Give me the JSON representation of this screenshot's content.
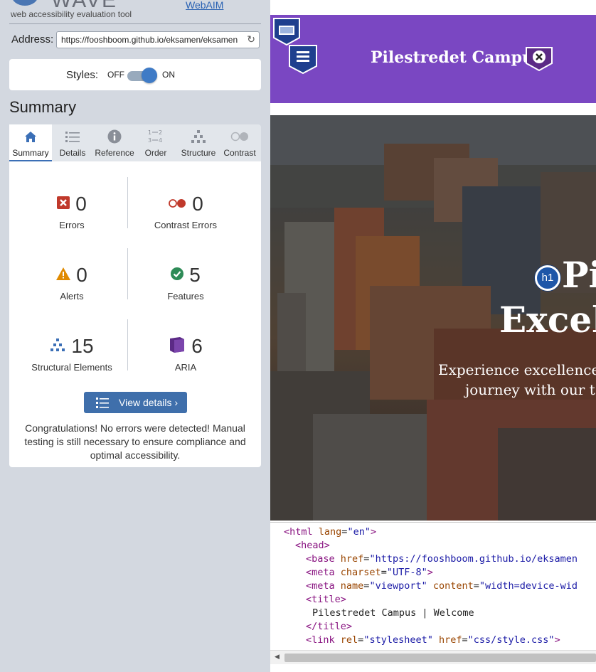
{
  "wave": {
    "logo_text": "WAVE",
    "tagline": "web accessibility evaluation tool",
    "webaim_link": "WebAIM",
    "address_label": "Address:",
    "address_value": "https://fooshboom.github.io/eksamen/eksamen",
    "styles_label": "Styles:",
    "styles_off": "OFF",
    "styles_on": "ON",
    "styles_enabled": true,
    "summary_heading": "Summary",
    "tabs": [
      {
        "label": "Summary",
        "icon": "home-icon",
        "active": true
      },
      {
        "label": "Details",
        "icon": "list-icon",
        "active": false
      },
      {
        "label": "Reference",
        "icon": "info-icon",
        "active": false
      },
      {
        "label": "Order",
        "icon": "order-icon",
        "active": false
      },
      {
        "label": "Structure",
        "icon": "structure-icon",
        "active": false
      },
      {
        "label": "Contrast",
        "icon": "contrast-icon",
        "active": false
      }
    ],
    "stats": {
      "errors": {
        "value": "0",
        "label": "Errors"
      },
      "contrast_errors": {
        "value": "0",
        "label": "Contrast Errors"
      },
      "alerts": {
        "value": "0",
        "label": "Alerts"
      },
      "features": {
        "value": "5",
        "label": "Features"
      },
      "structural": {
        "value": "15",
        "label": "Structural Elements"
      },
      "aria": {
        "value": "6",
        "label": "ARIA"
      }
    },
    "view_details": "View details ›",
    "congrats": "Congratulations! No errors were detected! Manual testing is still necessary to ensure compliance and optimal accessibility."
  },
  "site": {
    "brand": "Pilestredet Campus",
    "hero_title_line1": "Pi",
    "hero_title_line2": "Excel",
    "hero_sub_line1": "Experience excellence",
    "hero_sub_line2": "journey with our t",
    "h1_badge": "h1",
    "code": {
      "l1": {
        "t1": "<html ",
        "a1": "lang",
        "e1": "=",
        "v1": "\"en\"",
        "t2": ">"
      },
      "l2": {
        "t1": "<head>"
      },
      "l3": {
        "t1": "<base ",
        "a1": "href",
        "e1": "=",
        "v1": "\"https://fooshboom.github.io/eksamen"
      },
      "l4": {
        "t1": "<meta ",
        "a1": "charset",
        "e1": "=",
        "v1": "\"UTF-8\"",
        "t2": ">"
      },
      "l5": {
        "t1": "<meta ",
        "a1": "name",
        "e1": "=",
        "v1": "\"viewport\"",
        "a2": " content",
        "e2": "=",
        "v2": "\"width=device-wid"
      },
      "l6": {
        "t1": "<title>"
      },
      "l7": {
        "x1": "Pilestredet Campus | Welcome"
      },
      "l8": {
        "t1": "</title>"
      },
      "l9": {
        "t1": "<link ",
        "a1": "rel",
        "e1": "=",
        "v1": "\"stylesheet\"",
        "a2": " href",
        "e2": "=",
        "v2": "\"css/style.css\"",
        "t2": ">"
      }
    }
  },
  "colors": {
    "wave_bg": "#d3d8e0",
    "accent_blue": "#3f6fab",
    "error_red": "#c0392b",
    "alert_orange": "#e08a00",
    "feature_green": "#2e8b57",
    "aria_purple": "#5b2a86",
    "site_header_purple": "#7a47c2"
  }
}
